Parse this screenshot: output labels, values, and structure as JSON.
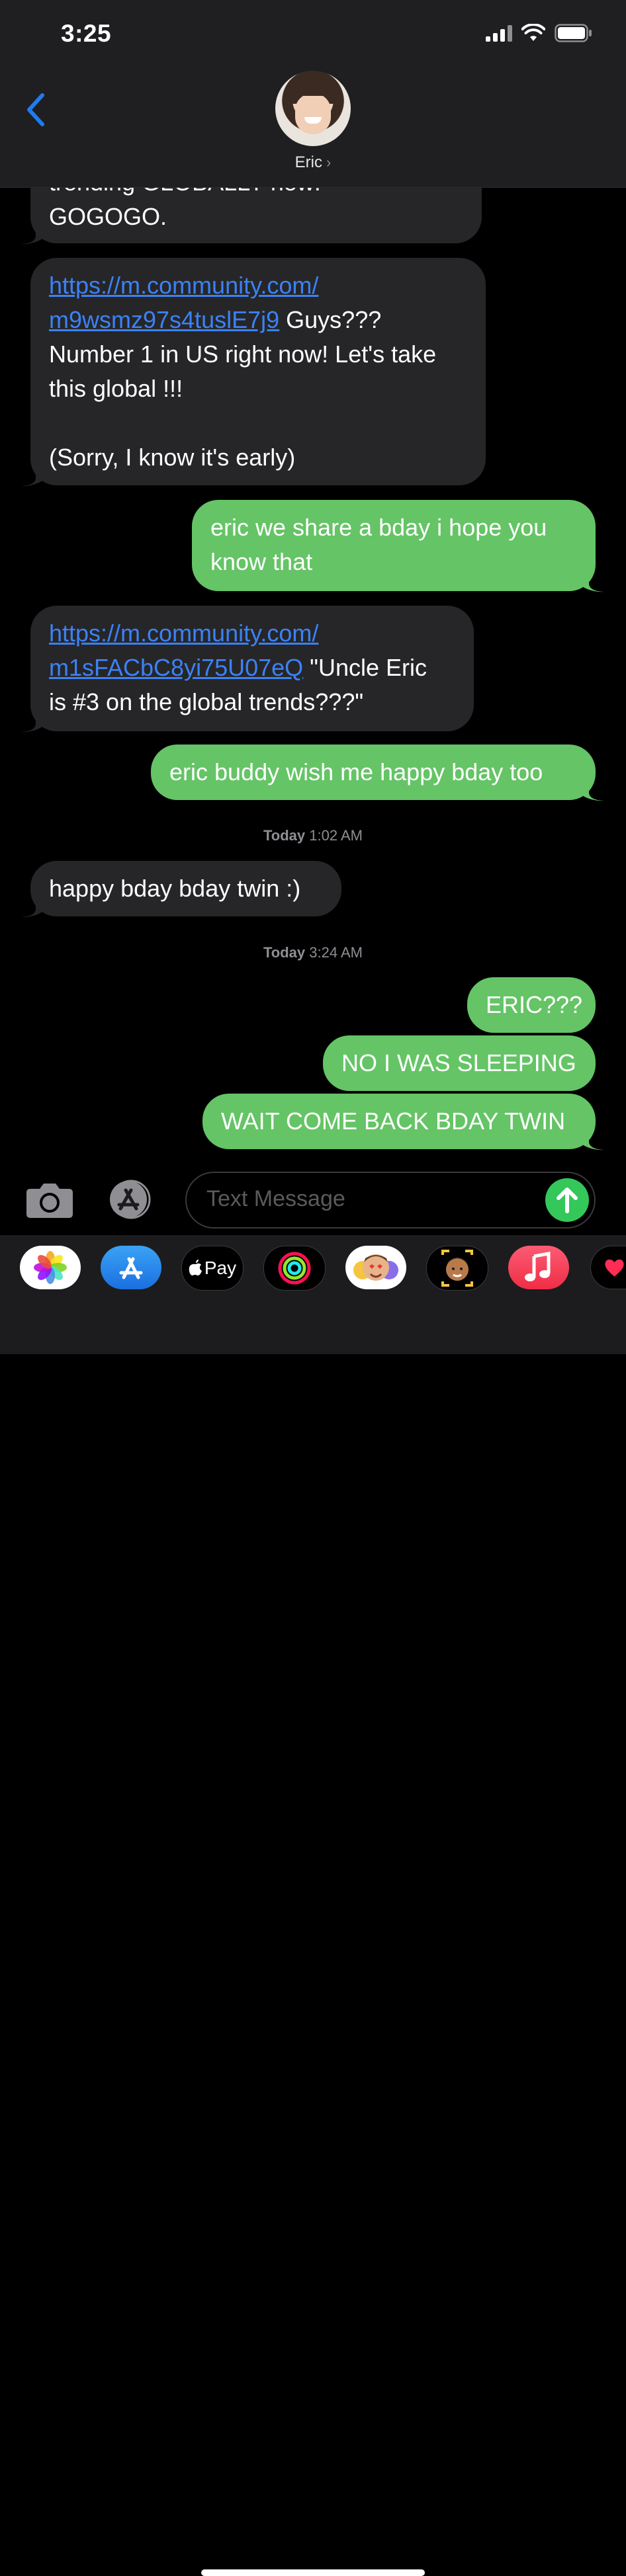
{
  "status_bar": {
    "time": "3:25"
  },
  "header": {
    "contact_name": "Eric",
    "chevron": "›"
  },
  "messages": [
    {
      "from": "them",
      "lines": [
        "trending GLOBALLY now!",
        "GOGOGO."
      ]
    },
    {
      "from": "them",
      "link_line1": "https://m.community.com/",
      "link_line2": "m9wsmz97s4tuslE7j9",
      "text_after_link": " Guys???",
      "line3": "Number 1 in US right now! Let's take",
      "line4": "this global !!!",
      "line5": "(Sorry, I know it's early)"
    },
    {
      "from": "me",
      "line1": "eric we share a bday i hope you",
      "line2": "know that"
    },
    {
      "from": "them",
      "link_line1": "https://m.community.com/",
      "link_line2": "m1sFACbC8yi75U07eQ",
      "text_after_link": " \"Uncle Eric",
      "line3": "is #3 on the global trends???\""
    },
    {
      "from": "me",
      "text": "eric buddy wish me happy bday too"
    },
    {
      "from": "them",
      "text": "happy bday bday twin :)"
    },
    {
      "from": "me",
      "text": "ERIC???"
    },
    {
      "from": "me",
      "text": "NO I WAS SLEEPING"
    },
    {
      "from": "me",
      "text": "WAIT COME BACK BDAY TWIN"
    }
  ],
  "timestamps": [
    {
      "day": "Today",
      "time": " 1:02 AM"
    },
    {
      "day": "Today",
      "time": " 3:24 AM"
    }
  ],
  "input": {
    "placeholder": "Text Message"
  },
  "drawer": {
    "apps": [
      "photos-icon",
      "app-store-icon",
      "apple-pay-icon",
      "activity-icon",
      "animoji-icon",
      "memoji-icon",
      "music-icon",
      "digital-touch-icon"
    ],
    "apple_pay_label": "Pay"
  },
  "colors": {
    "outgoing_bubble": "#65c466",
    "incoming_bubble": "#262628",
    "link": "#3b82f6",
    "accent_blue": "#1e7cf2",
    "send_button": "#34c759"
  }
}
